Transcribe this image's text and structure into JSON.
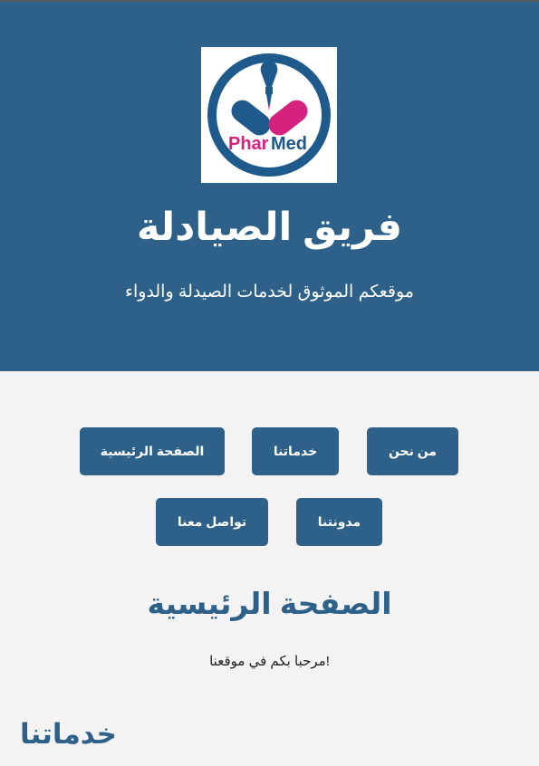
{
  "header": {
    "logo": {
      "icon": "pharmed-logo",
      "text_part1": "Phar",
      "text_part2": "Med",
      "colors": {
        "ring": "#1e5a8c",
        "blue_capsule": "#1e5a8c",
        "pink_capsule": "#d6227f"
      }
    },
    "title": "فريق الصيادلة",
    "subtitle": "موقعكم الموثوق لخدمات الصيدلة والدواء"
  },
  "nav": {
    "about": "من نحن",
    "services": "خدماتنا",
    "home": "الصفحة الرئيسية",
    "blog": "مدونتنا",
    "contact": "تواصل معنا"
  },
  "main": {
    "home_title": "الصفحة الرئيسية",
    "welcome_text": "!مرحبا بكم في موقعنا",
    "services_heading": "خدماتنا"
  },
  "colors": {
    "primary": "#2d6189",
    "background": "#f3f3f3",
    "text": "#222222"
  }
}
